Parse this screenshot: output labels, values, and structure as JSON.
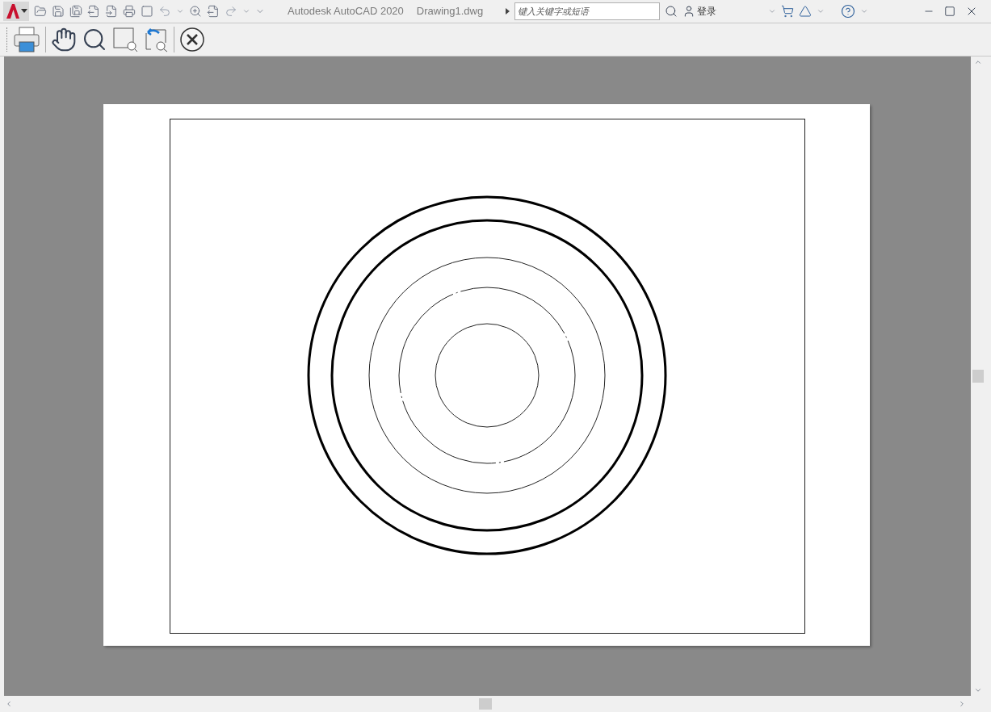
{
  "title_bar": {
    "app_title": "Autodesk AutoCAD 2020",
    "document_title": "Drawing1.dwg",
    "search": {
      "placeholder": "键入关键字或短语"
    },
    "sign_in_label": "登录"
  }
}
